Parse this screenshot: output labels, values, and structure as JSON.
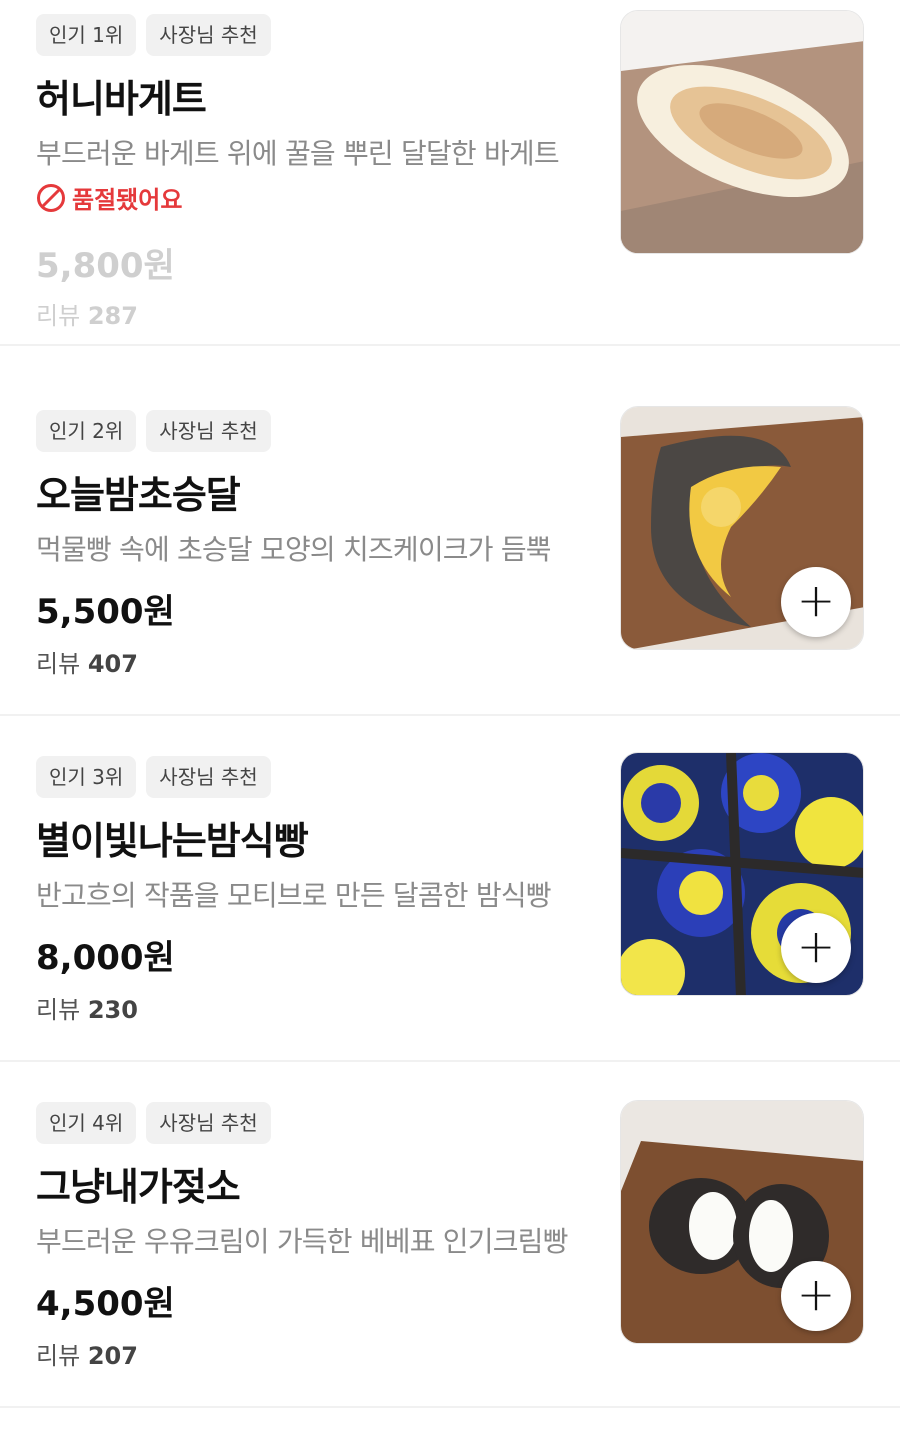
{
  "items": [
    {
      "rank_badge": "인기 1위",
      "owner_badge": "사장님 추천",
      "name": "허니바게트",
      "description": "부드러운 바게트 위에 꿀을 뿌린 달달한 바게트",
      "status": "품절됐어요",
      "price": "5,800원",
      "review_label": "리뷰",
      "review_count": "287"
    },
    {
      "rank_badge": "인기 2위",
      "owner_badge": "사장님 추천",
      "name": "오늘밤초승달",
      "description": "먹물빵 속에 초승달 모양의 치즈케이크가 듬뿍",
      "price": "5,500원",
      "review_label": "리뷰",
      "review_count": "407",
      "add_symbol": "+"
    },
    {
      "rank_badge": "인기 3위",
      "owner_badge": "사장님 추천",
      "name": "별이빛나는밤식빵",
      "description": "반고흐의 작품을 모티브로 만든 달콤한 밤식빵",
      "price": "8,000원",
      "review_label": "리뷰",
      "review_count": "230",
      "add_symbol": "+"
    },
    {
      "rank_badge": "인기 4위",
      "owner_badge": "사장님 추천",
      "name": "그냥내가젖소",
      "description": "부드러운 우유크림이 가득한 베베표 인기크림빵",
      "price": "4,500원",
      "review_label": "리뷰",
      "review_count": "207",
      "add_symbol": "+"
    }
  ],
  "colors": {
    "soldout_red": "#e5393b",
    "badge_bg": "#f1f1f1",
    "desc_gray": "#8a8a8a",
    "divider": "#f1f1f1"
  }
}
